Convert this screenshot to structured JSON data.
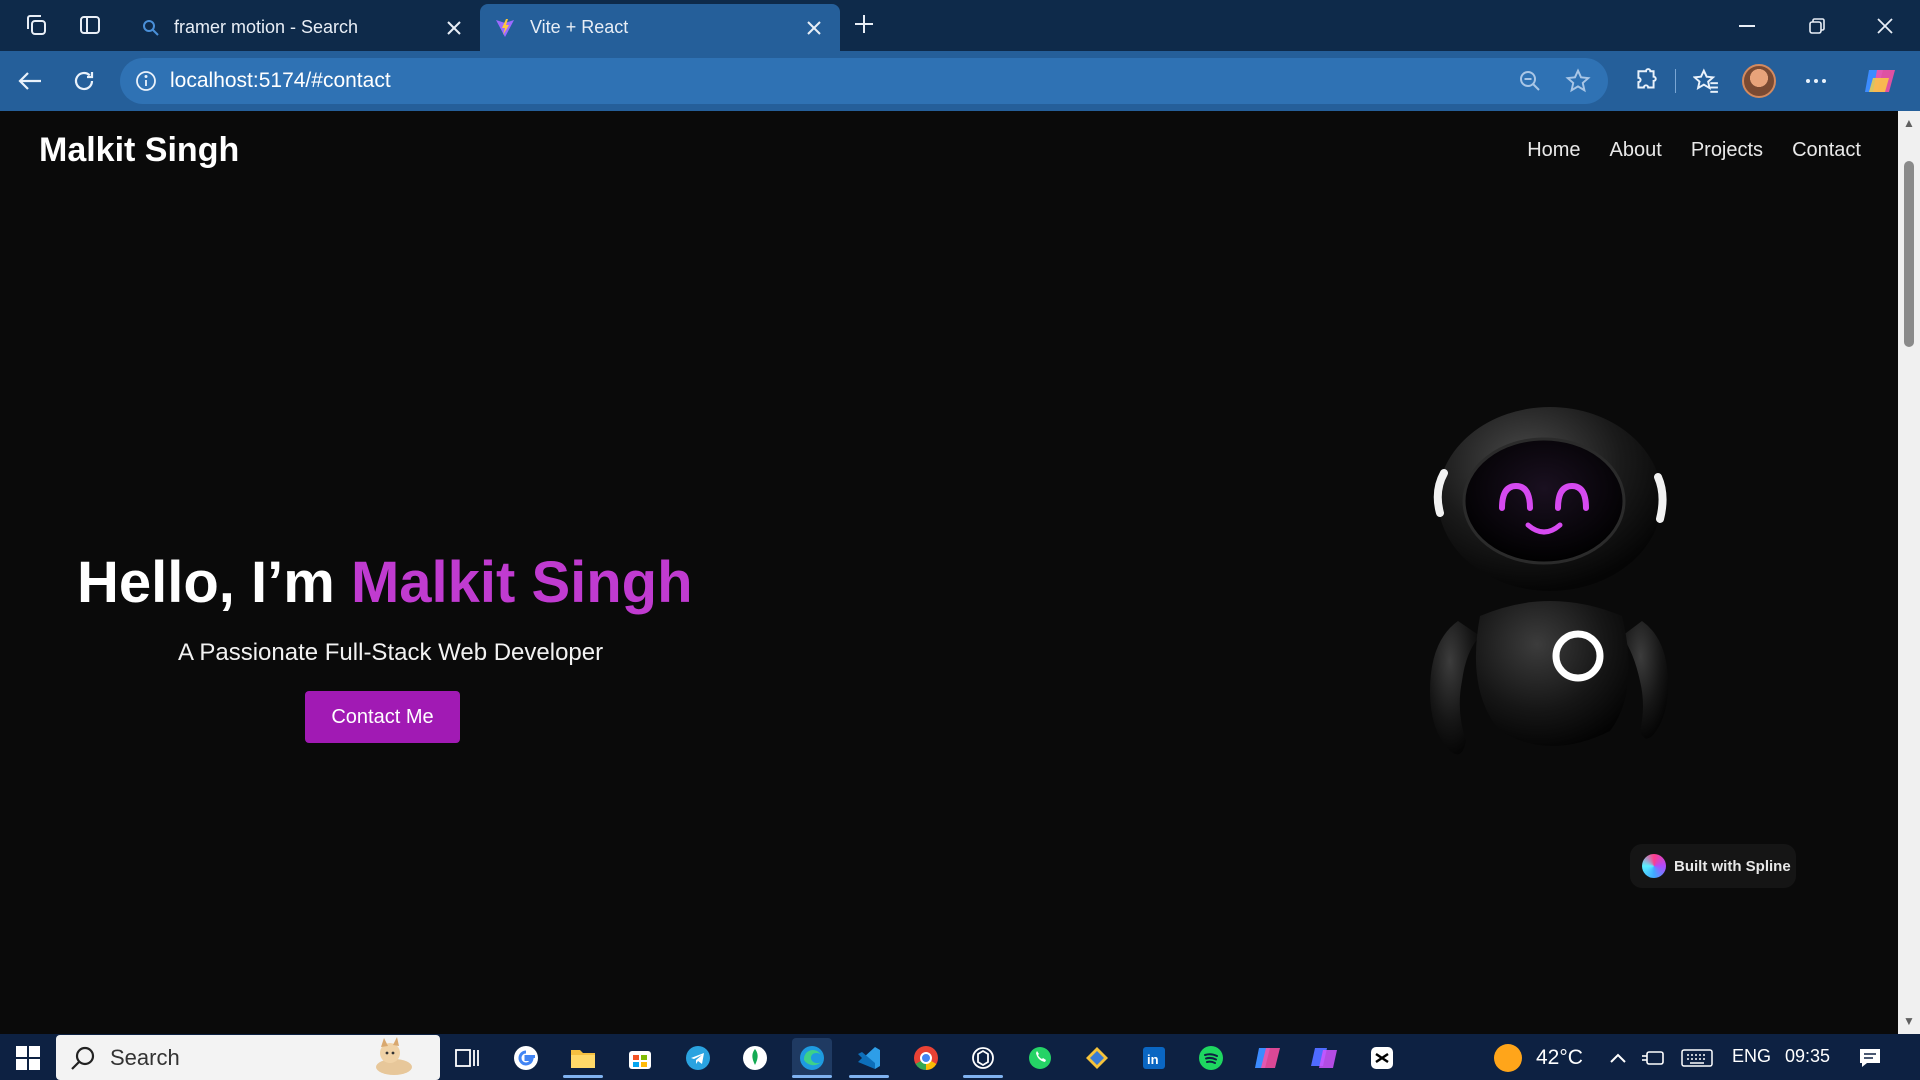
{
  "browser": {
    "tabs": [
      {
        "title": "framer motion - Search",
        "active": false
      },
      {
        "title": "Vite + React",
        "active": true
      }
    ],
    "url": "localhost:5174/#contact"
  },
  "site": {
    "brand": "Malkit Singh",
    "nav": [
      "Home",
      "About",
      "Projects",
      "Contact"
    ],
    "hero": {
      "greeting": "Hello, I’m ",
      "name": "Malkit Singh",
      "subtitle": "A Passionate Full-Stack Web Developer",
      "cta": "Contact Me"
    },
    "badge": "Built with Spline",
    "colors": {
      "accent": "#c03bd0",
      "button": "#a11ab4",
      "background": "#0a0a0a"
    }
  },
  "taskbar": {
    "search_label": "Search",
    "weather": "42°C",
    "language": "ENG",
    "time": "09:35"
  }
}
